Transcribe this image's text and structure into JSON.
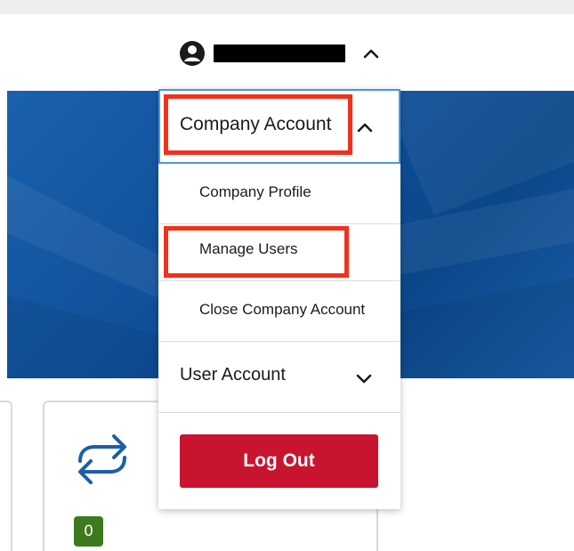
{
  "user_menu": {
    "avatar_icon": "user-circle-icon",
    "toggle_icon": "chevron-up-icon"
  },
  "dropdown": {
    "company_account": {
      "label": "Company Account",
      "icon": "chevron-up-icon",
      "items": [
        {
          "label": "Company Profile"
        },
        {
          "label": "Manage Users"
        },
        {
          "label": "Close Company Account"
        }
      ]
    },
    "user_account": {
      "label": "User Account",
      "icon": "chevron-down-icon"
    },
    "logout_label": "Log Out"
  },
  "card": {
    "icon": "swap-arrows-icon",
    "count": "0"
  },
  "colors": {
    "highlight": "#f0321c",
    "focus_border": "#4a95e8",
    "logout": "#c8142f",
    "badge": "#3d7a1f",
    "hero": "#0f4f98",
    "icon_blue": "#1b5fa8"
  }
}
